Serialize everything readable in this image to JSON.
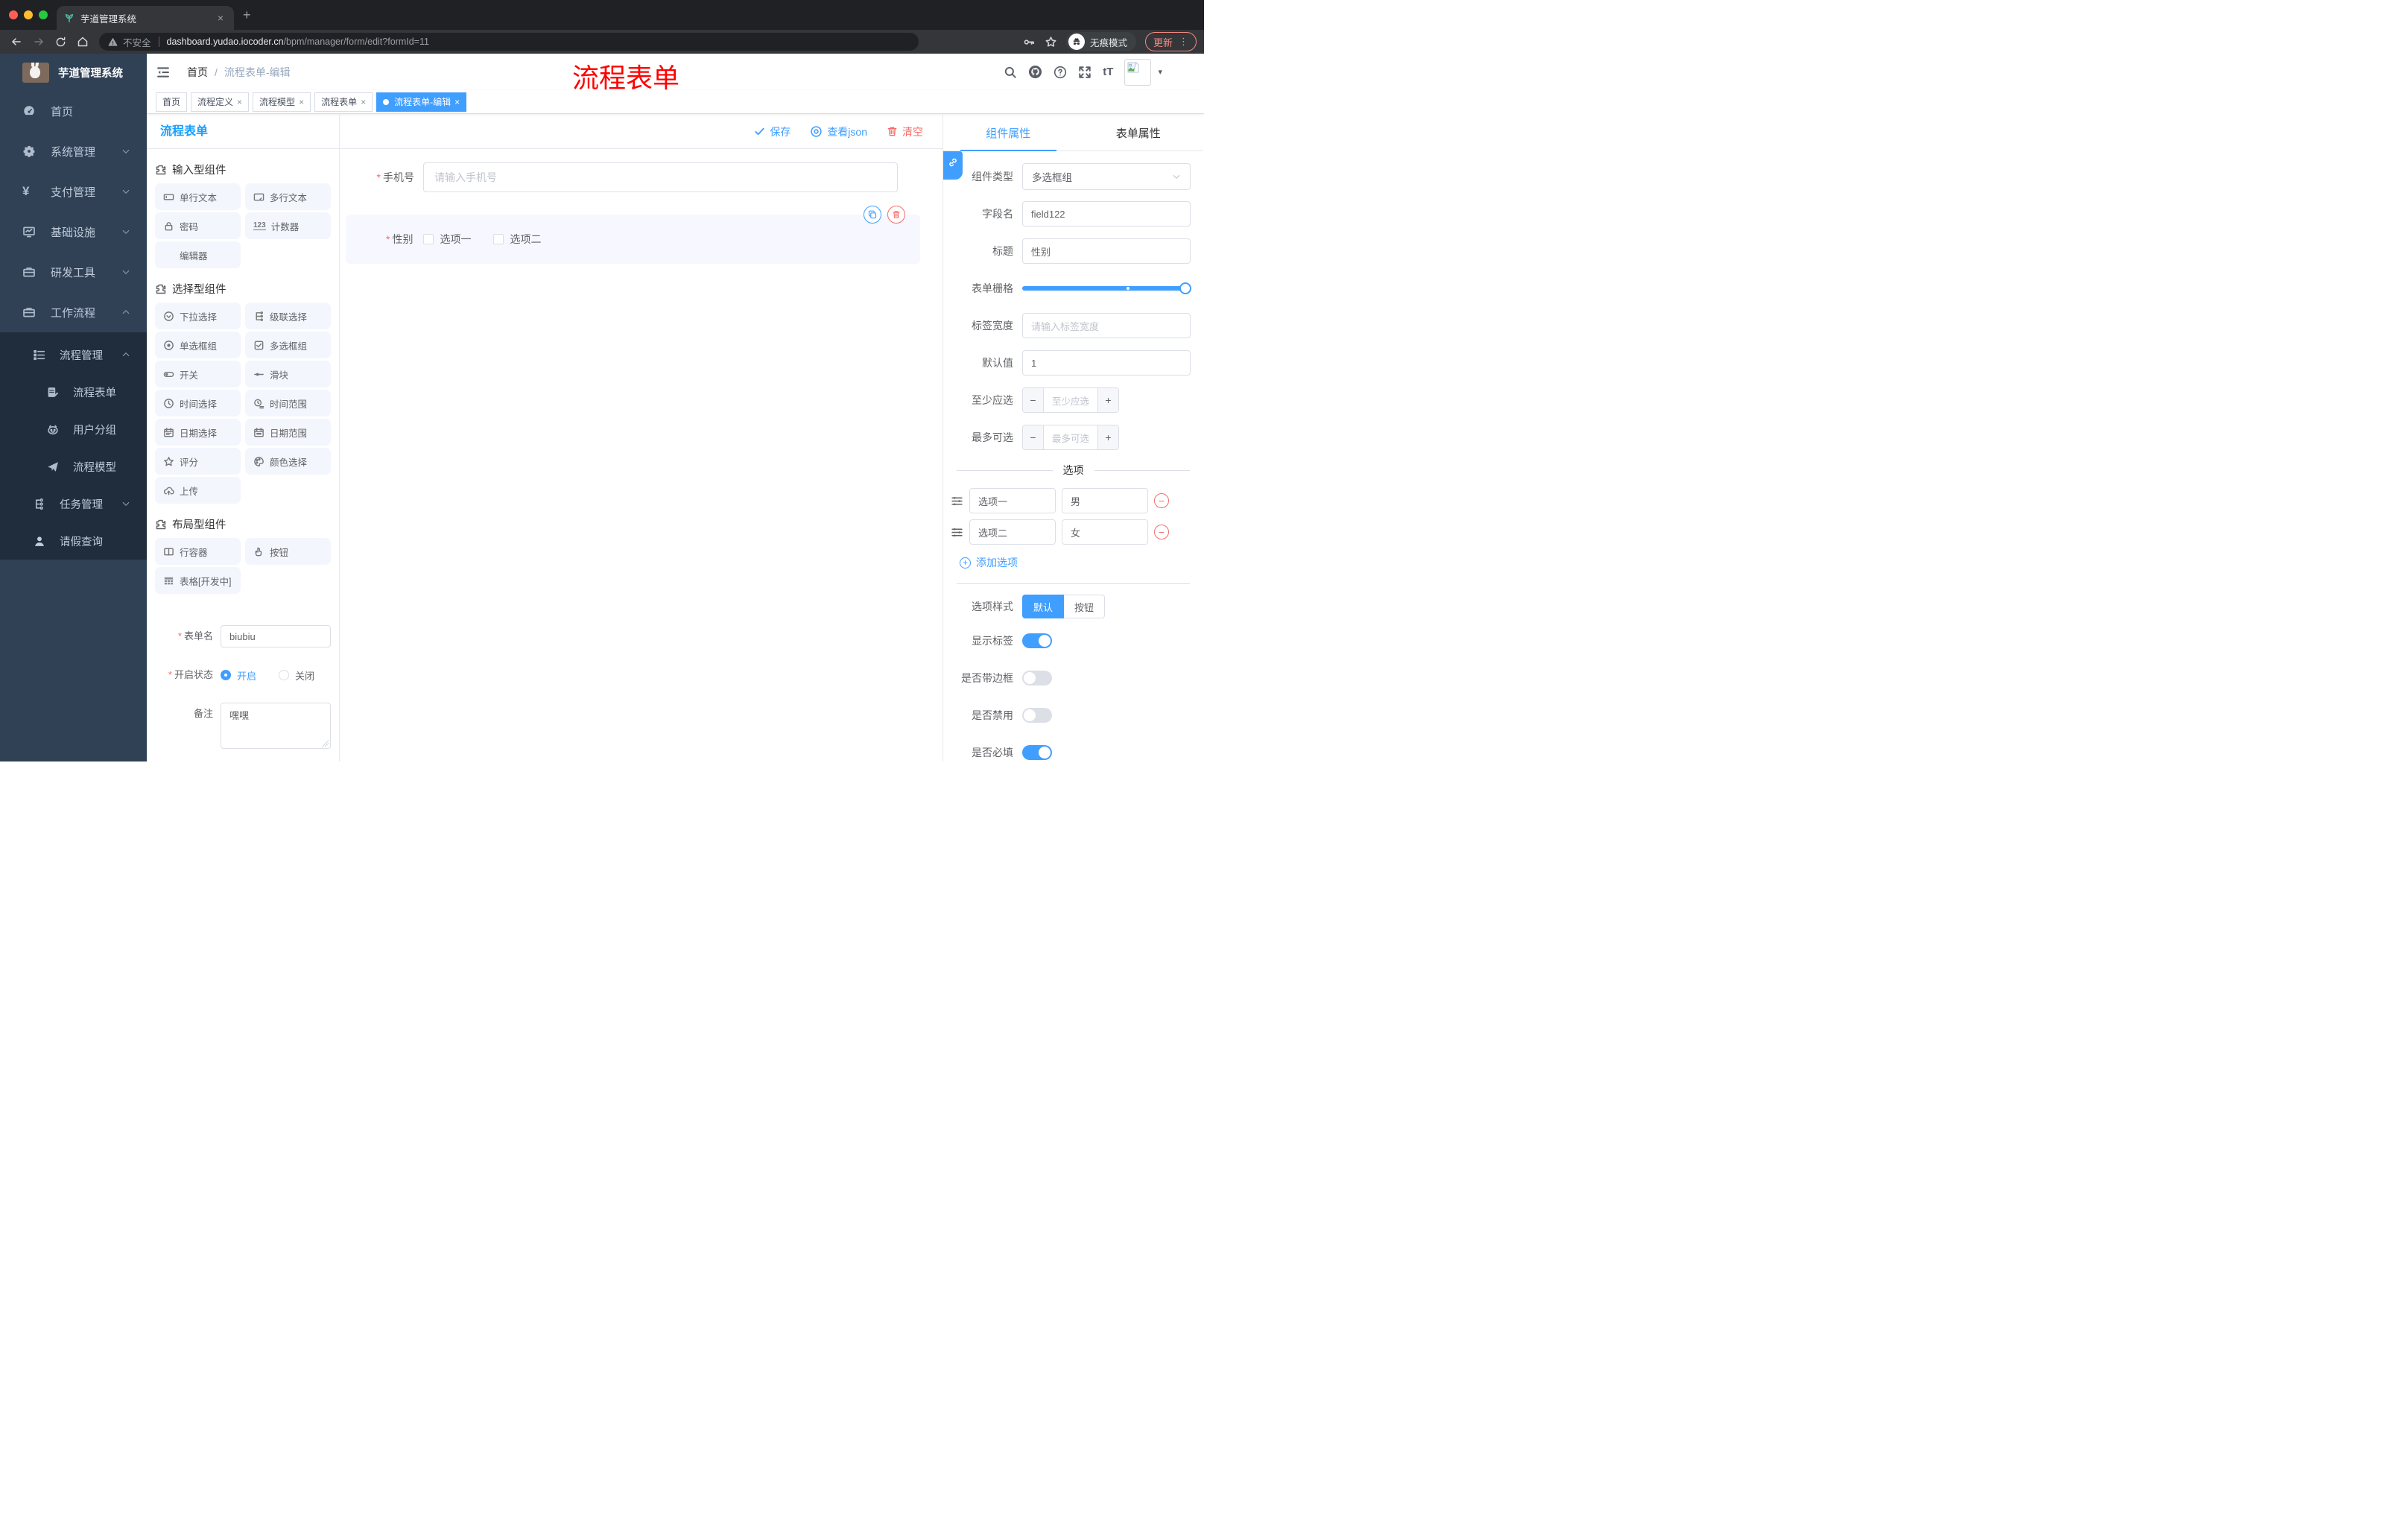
{
  "icons": {
    "close": "×",
    "plus": "+",
    "minus": "−",
    "dots": "⋮",
    "caret": "▾",
    "slash": "/",
    "font_size": "tT",
    "counter": "123"
  },
  "browser": {
    "tab_title": "芋道管理系统",
    "security_label": "不安全",
    "url_domain": "dashboard.yudao.iocoder.cn",
    "url_path": "/bpm/manager/form/edit?formId=11",
    "incognito_label": "无痕模式",
    "update_label": "更新"
  },
  "annotation": {
    "text": "流程表单",
    "color": "#ff0000"
  },
  "sidebar": {
    "logo_title": "芋道管理系统",
    "items": [
      {
        "label": "首页",
        "icon": "dashboard-icon",
        "chevron": "none"
      },
      {
        "label": "系统管理",
        "icon": "gear-icon",
        "chevron": "down"
      },
      {
        "label": "支付管理",
        "icon": "yen-icon",
        "chevron": "down"
      },
      {
        "label": "基础设施",
        "icon": "monitor-icon",
        "chevron": "down"
      },
      {
        "label": "研发工具",
        "icon": "toolbox-icon",
        "chevron": "down"
      },
      {
        "label": "工作流程",
        "icon": "toolbox-icon",
        "chevron": "up"
      }
    ],
    "submenu": [
      {
        "label": "流程管理",
        "icon": "list-tree-icon",
        "chevron": "up"
      },
      {
        "label": "流程表单",
        "icon": "form-doc-icon"
      },
      {
        "label": "用户分组",
        "icon": "robot-icon"
      },
      {
        "label": "流程模型",
        "icon": "send-icon"
      },
      {
        "label": "任务管理",
        "icon": "branch-icon",
        "chevron": "down"
      },
      {
        "label": "请假查询",
        "icon": "user-icon"
      }
    ]
  },
  "header": {
    "breadcrumb_home": "首页",
    "breadcrumb_current": "流程表单-编辑"
  },
  "tags": [
    {
      "label": "首页",
      "closable": false,
      "active": false
    },
    {
      "label": "流程定义",
      "closable": true,
      "active": false
    },
    {
      "label": "流程模型",
      "closable": true,
      "active": false
    },
    {
      "label": "流程表单",
      "closable": true,
      "active": false
    },
    {
      "label": "流程表单-编辑",
      "closable": true,
      "active": true
    }
  ],
  "builder": {
    "panel_title": "流程表单",
    "palette": [
      {
        "title": "输入型组件",
        "items": [
          {
            "label": "单行文本",
            "icon": "input-icon"
          },
          {
            "label": "多行文本",
            "icon": "textarea-icon"
          },
          {
            "label": "密码",
            "icon": "lock-icon"
          },
          {
            "label": "计数器",
            "icon": "counter-icon"
          },
          {
            "label": "编辑器",
            "icon": ""
          }
        ]
      },
      {
        "title": "选择型组件",
        "items": [
          {
            "label": "下拉选择",
            "icon": "select-icon"
          },
          {
            "label": "级联选择",
            "icon": "cascade-icon"
          },
          {
            "label": "单选框组",
            "icon": "radio-icon"
          },
          {
            "label": "多选框组",
            "icon": "checkbox-icon"
          },
          {
            "label": "开关",
            "icon": "switch-icon"
          },
          {
            "label": "滑块",
            "icon": "slider-icon"
          },
          {
            "label": "时间选择",
            "icon": "clock-icon"
          },
          {
            "label": "时间范围",
            "icon": "clock-range-icon"
          },
          {
            "label": "日期选择",
            "icon": "calendar-icon"
          },
          {
            "label": "日期范围",
            "icon": "calendar-range-icon"
          },
          {
            "label": "评分",
            "icon": "star-icon"
          },
          {
            "label": "颜色选择",
            "icon": "palette-icon"
          },
          {
            "label": "上传",
            "icon": "upload-icon"
          }
        ]
      },
      {
        "title": "布局型组件",
        "items": [
          {
            "label": "行容器",
            "icon": "row-icon"
          },
          {
            "label": "按钮",
            "icon": "pointer-icon"
          },
          {
            "label": "表格[开发中]",
            "icon": "table-icon"
          }
        ]
      }
    ],
    "form_meta": {
      "name_label": "表单名",
      "name_value": "biubiu",
      "status_label": "开启状态",
      "status_on": "开启",
      "status_off": "关闭",
      "remark_label": "备注",
      "remark_value": "嘿嘿"
    },
    "toolbar": {
      "save": "保存",
      "view_json": "查看json",
      "clear": "清空"
    },
    "canvas": {
      "phone_label": "手机号",
      "phone_placeholder": "请输入手机号",
      "gender_label": "性别",
      "gender_options": [
        {
          "label": "选项一"
        },
        {
          "label": "选项二"
        }
      ]
    },
    "props": {
      "tab_component": "组件属性",
      "tab_form": "表单属性",
      "component_type_label": "组件类型",
      "component_type_value": "多选框组",
      "field_name_label": "字段名",
      "field_name_value": "field122",
      "title_label": "标题",
      "title_value": "性别",
      "grid_label": "表单栅格",
      "label_width_label": "标签宽度",
      "label_width_placeholder": "请输入标签宽度",
      "default_label": "默认值",
      "default_value": "1",
      "min_label": "至少应选",
      "min_placeholder": "至少应选",
      "max_label": "最多可选",
      "max_placeholder": "最多可选",
      "options_title": "选项",
      "options": [
        {
          "label": "选项一",
          "value": "男"
        },
        {
          "label": "选项二",
          "value": "女"
        }
      ],
      "add_option_label": "添加选项",
      "style_label": "选项样式",
      "style_default": "默认",
      "style_button": "按钮",
      "switches": [
        {
          "label": "显示标签",
          "on": true
        },
        {
          "label": "是否带边框",
          "on": false
        },
        {
          "label": "是否禁用",
          "on": false
        },
        {
          "label": "是否必填",
          "on": true
        }
      ]
    }
  },
  "colors": {
    "accent": "#409eff",
    "title_blue": "#189fff",
    "danger": "#f56c6c",
    "sidebar": "#304156",
    "submenu": "#1f2d3d"
  }
}
